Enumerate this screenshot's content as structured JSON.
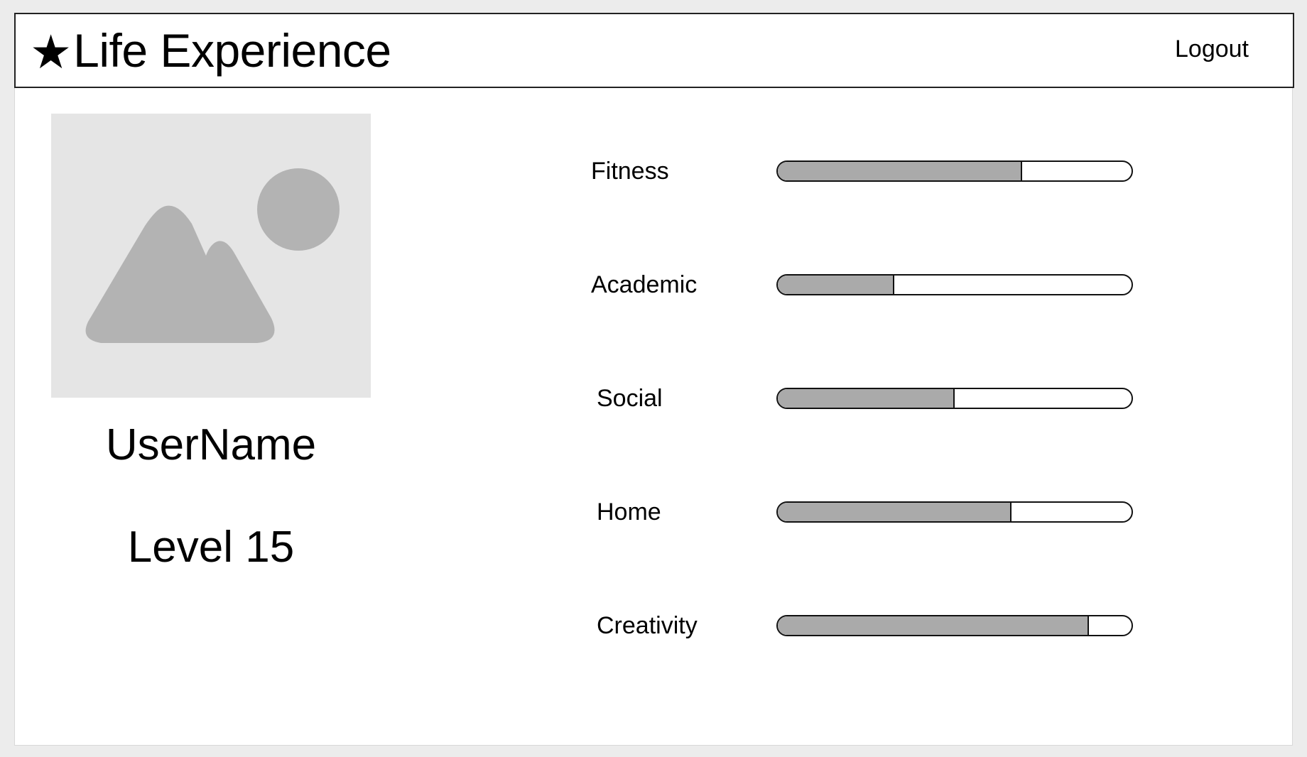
{
  "header": {
    "star_icon": "★",
    "title": "Life Experience",
    "logout_label": "Logout"
  },
  "profile": {
    "avatar_icon": "image-placeholder-icon",
    "username": "UserName",
    "level_text": "Level 15"
  },
  "stats": [
    {
      "label": "Fitness",
      "progress": 0.69
    },
    {
      "label": "Academic",
      "progress": 0.33
    },
    {
      "label": "Social",
      "progress": 0.5
    },
    {
      "label": "Home",
      "progress": 0.66
    },
    {
      "label": "Creativity",
      "progress": 0.88
    }
  ],
  "colors": {
    "background": "#ececec",
    "panel": "#ffffff",
    "bar_fill": "#aaaaaa",
    "placeholder": "#e5e5e5",
    "placeholder_shape": "#b3b3b3"
  }
}
